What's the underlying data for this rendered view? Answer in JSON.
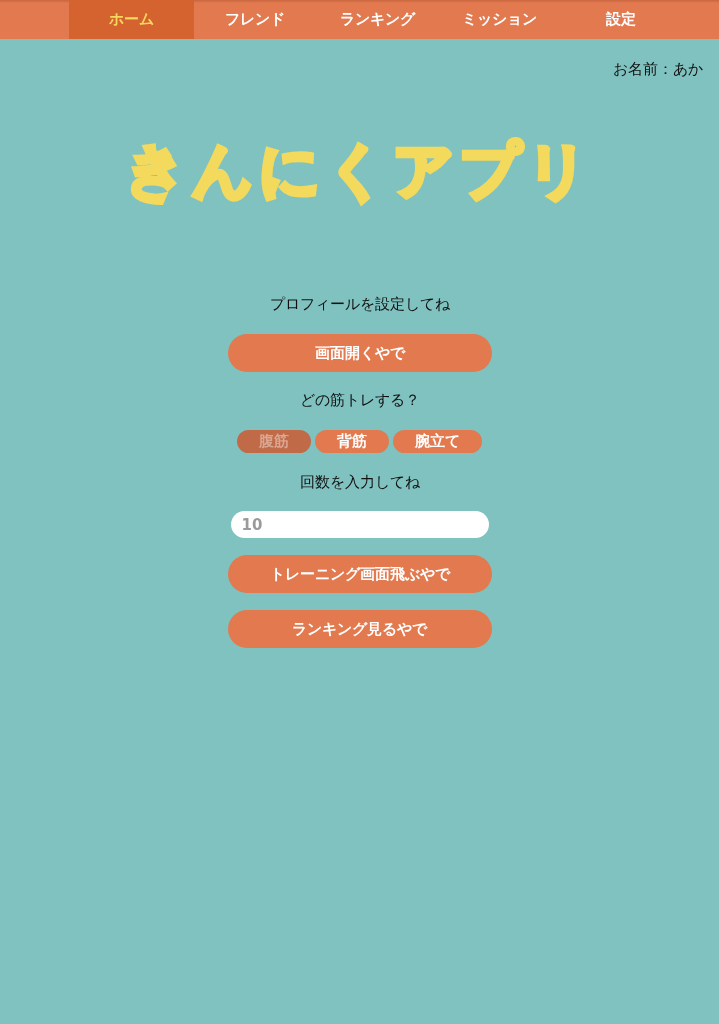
{
  "nav": {
    "tabs": [
      {
        "label": "ホーム",
        "selected": true
      },
      {
        "label": "フレンド",
        "selected": false
      },
      {
        "label": "ランキング",
        "selected": false
      },
      {
        "label": "ミッション",
        "selected": false
      },
      {
        "label": "設定",
        "selected": false
      }
    ]
  },
  "user": {
    "name_label": "お名前：あか"
  },
  "logo": {
    "text": "きんにくアプリ"
  },
  "profile": {
    "prompt": "プロフィールを設定してね",
    "button": "画面開くやで"
  },
  "exercise": {
    "prompt": "どの筋トレする？",
    "options": [
      {
        "label": "腹筋",
        "selected": true
      },
      {
        "label": "背筋",
        "selected": false
      },
      {
        "label": "腕立て",
        "selected": false
      }
    ]
  },
  "count": {
    "prompt": "回数を入力してね",
    "placeholder": "10"
  },
  "actions": [
    "トレーニング画面飛ぶやで",
    "ランキング見るやで"
  ]
}
